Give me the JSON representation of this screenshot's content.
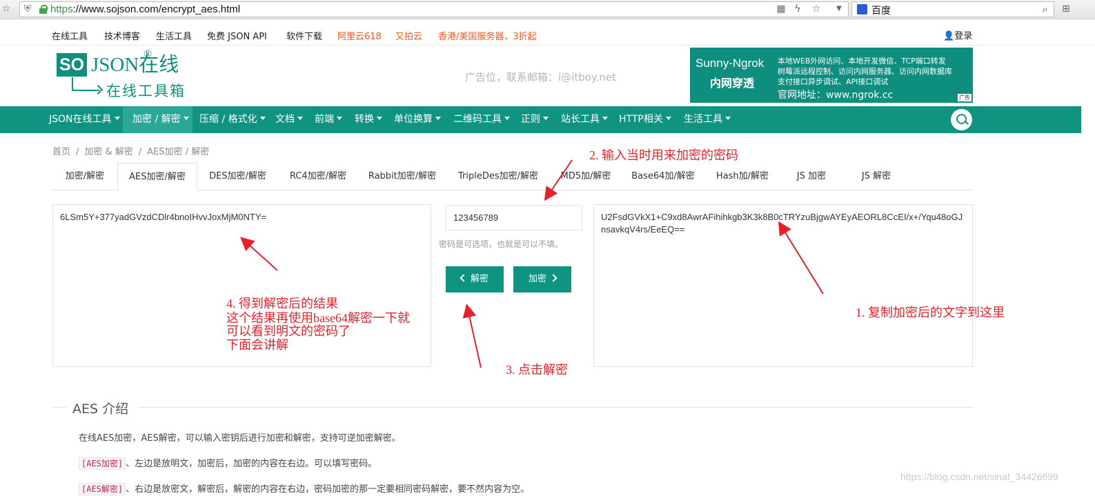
{
  "browser": {
    "url_scheme": "https",
    "url_rest": "://www.sojson.com/encrypt_aes.html",
    "search_engine": "百度"
  },
  "topnav": {
    "items": [
      "在线工具",
      "技术博客",
      "生活工具",
      "免费 JSON API",
      "软件下载"
    ],
    "promos": [
      "阿里云618",
      "又拍云",
      "香港/美国服务器，3折起"
    ],
    "login": "登录"
  },
  "header": {
    "logo_so": "SO",
    "logo_json": "JSON在线",
    "logo_reg": "®",
    "logo_tagline": "在线工具箱",
    "ad_text": "广告位，联系邮箱：i@itboy.net",
    "banner": {
      "title": "Sunny-Ngrok",
      "subtitle": "内网穿透",
      "lines": [
        "本地WEB外网访问、本地开发微信、TCP端口转发",
        "树莓派远程控制、访问内网服务器、访问内网数据库",
        "支付接口异步调试、API接口调试"
      ],
      "url": "官网地址：www.ngrok.cc",
      "tag": "广告"
    }
  },
  "mainnav": {
    "items": [
      "JSON在线工具",
      "加密 / 解密",
      "压缩 / 格式化",
      "文档",
      "前端",
      "转换",
      "单位换算",
      "二维码工具",
      "正则",
      "站长工具",
      "HTTP相关",
      "生活工具"
    ]
  },
  "breadcrumb": [
    "首页",
    "加密 & 解密",
    "AES加密 / 解密"
  ],
  "tabs": [
    "加密/解密",
    "AES加密/解密",
    "DES加密/解密",
    "RC4加密/解密",
    "Rabbit加密/解密",
    "TripleDes加密/解密",
    "MD5加/解密",
    "Base64加/解密",
    "Hash加/解密",
    "JS 加密",
    "JS 解密"
  ],
  "editor": {
    "left_text": "6LSm5Y+377yadGVzdCDlr4bnoIHvvJoxMjM0NTY=",
    "password_value": "123456789",
    "password_hint": "密码是可选项，也就是可以不填。",
    "decrypt_label": "解密",
    "encrypt_label": "加密",
    "right_text": "U2FsdGVkX1+C9xd8AwrAFihihkgb3K3k8B0cTRYzuBjgwAYEyAEORL8CcEI/x+/Yqu48oGJnsavkqV4rs/EeEQ=="
  },
  "annotations": {
    "step1": "1. 复制加密后的文字到这里",
    "step2": "2. 输入当时用来加密的密码",
    "step3": "3. 点击解密",
    "step4_lines": [
      "4. 得到解密后的结果",
      "这个结果再使用base64解密一下就",
      "可以看到明文的密码了",
      "下面会讲解"
    ]
  },
  "intro": {
    "title": "AES 介绍",
    "p1": "在线AES加密，AES解密，可以输入密钥后进行加密和解密，支持可逆加密解密。",
    "p2_code": "[AES加密]",
    "p2_text": "、左边是放明文，加密后，加密的内容在右边。可以填写密码。",
    "p3_code": "[AES解密]",
    "p3_text": "、右边是放密文，解密后，解密的内容在右边，密码加密的那一定要相同密码解密，要不然内容为空。"
  },
  "watermark": "https://blog.csdn.net/sinat_34426699",
  "colors": {
    "brand": "#0f9482",
    "annotation": "#e8202a",
    "promo": "#ee5a24"
  }
}
